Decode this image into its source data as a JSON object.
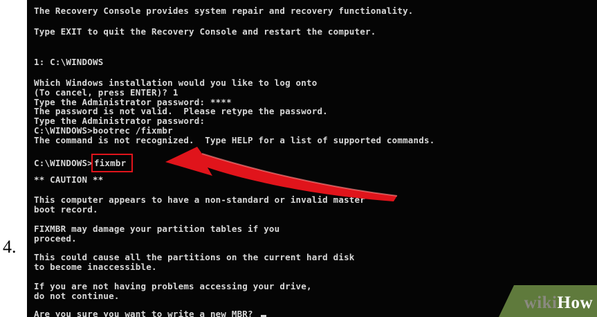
{
  "step": {
    "number": "4."
  },
  "console": {
    "lines": [
      "The Recovery Console provides system repair and recovery functionality.",
      "Type EXIT to quit the Recovery Console and restart the computer.",
      "1: C:\\WINDOWS",
      "Which Windows installation would you like to log onto",
      "(To cancel, press ENTER)? 1",
      "Type the Administrator password: ****",
      "The password is not valid.  Please retype the password.",
      "Type the Administrator password:",
      "C:\\WINDOWS>bootrec /fixmbr",
      "The command is not recognized.  Type HELP for a list of supported commands.",
      "** CAUTION **",
      "This computer appears to have a non-standard or invalid master",
      "boot record.",
      "FIXMBR may damage your partition tables if you",
      "proceed.",
      "This could cause all the partitions on the current hard disk",
      "to become inaccessible.",
      "If you are not having problems accessing your drive,",
      "do not continue.",
      "Are you sure you want to write a new MBR? "
    ],
    "prompt": "C:\\WINDOWS>",
    "highlighted_command": "fixmbr"
  },
  "colors": {
    "console_background": "#050505",
    "console_text": "#d8d8d8",
    "arrow": "#e0141b",
    "highlight_box": "#e0141b",
    "watermark_banner": "#5f7a3c"
  },
  "watermark": {
    "wiki": "wiki",
    "how": "How"
  }
}
